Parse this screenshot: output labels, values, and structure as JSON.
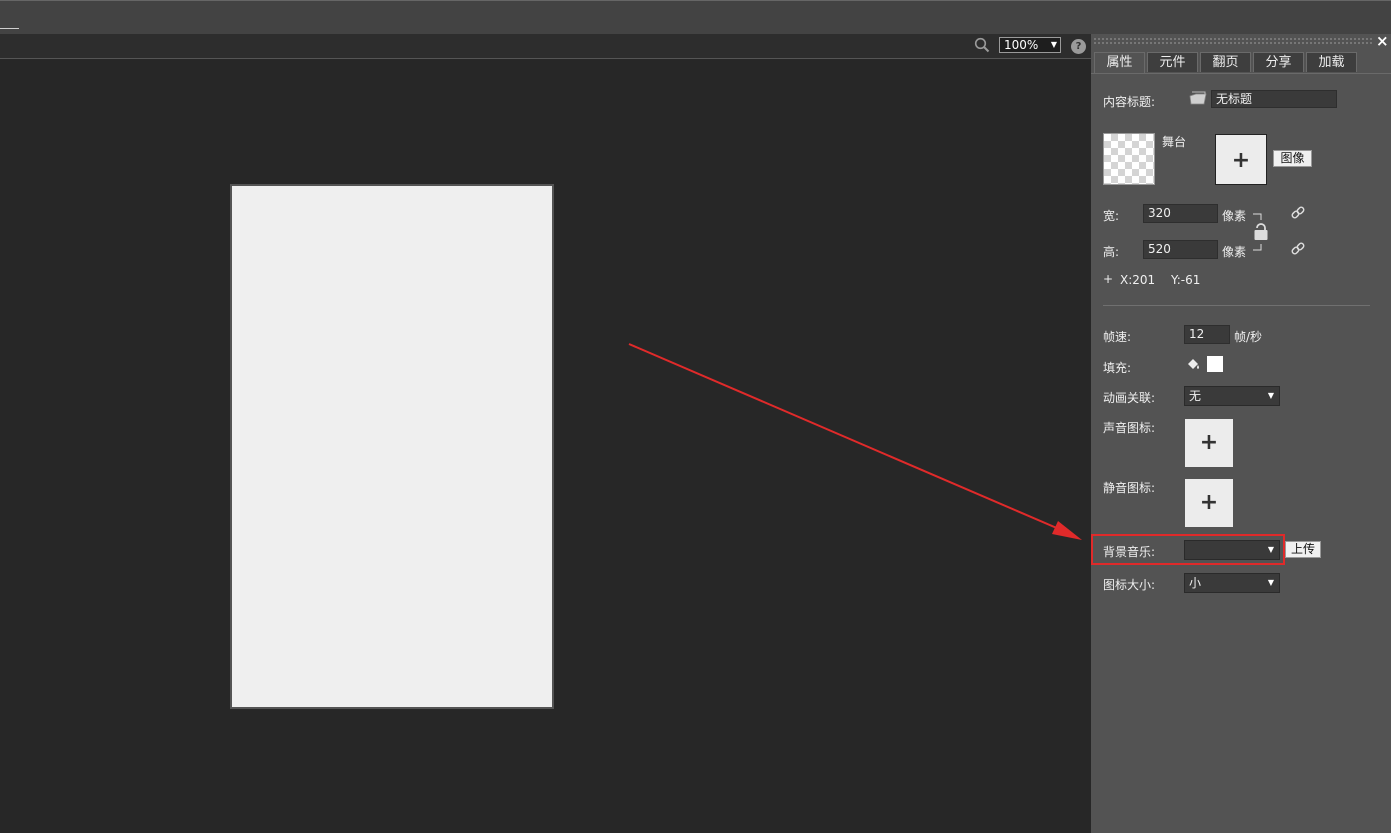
{
  "zoom": {
    "value": "100%",
    "help": "?"
  },
  "panel": {
    "close": "×",
    "tabs": [
      "属性",
      "元件",
      "翻页",
      "分享",
      "加载"
    ],
    "content_title": {
      "label": "内容标题:",
      "value": "无标题"
    },
    "stage": {
      "label": "舞台",
      "image_button": "图像",
      "plus": "+"
    },
    "width": {
      "label": "宽:",
      "value": "320",
      "unit": "像素"
    },
    "height": {
      "label": "高:",
      "value": "520",
      "unit": "像素"
    },
    "coords": {
      "plus": "+",
      "x": "X:201",
      "y": "Y:-61"
    },
    "frame_rate": {
      "label": "帧速:",
      "value": "12",
      "unit": "帧/秒"
    },
    "fill": {
      "label": "填充:",
      "color": "#ffffff"
    },
    "anim_link": {
      "label": "动画关联:",
      "value": "无"
    },
    "sound_icon": {
      "label": "声音图标:",
      "plus": "+"
    },
    "mute_icon": {
      "label": "静音图标:",
      "plus": "+"
    },
    "bg_music": {
      "label": "背景音乐:",
      "value": "",
      "upload": "上传"
    },
    "icon_size": {
      "label": "图标大小:",
      "value": "小"
    }
  },
  "colors": {
    "highlight": "#e02a2a",
    "arrow": "#e02a2a"
  }
}
